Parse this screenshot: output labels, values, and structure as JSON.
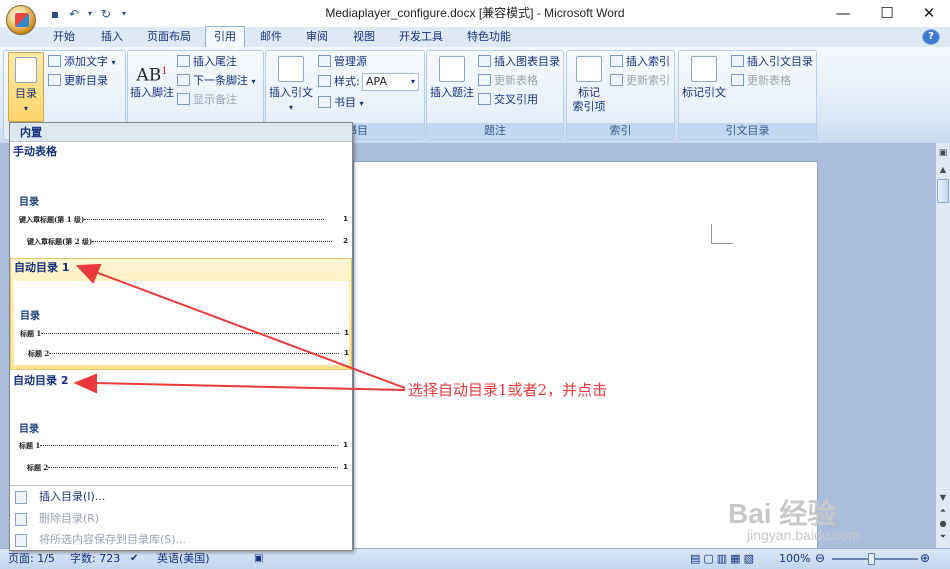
{
  "window": {
    "title": "Mediaplayer_configure.docx [兼容模式] - Microsoft Word"
  },
  "tabs": [
    "开始",
    "插入",
    "页面布局",
    "引用",
    "邮件",
    "审阅",
    "视图",
    "开发工具",
    "特色功能"
  ],
  "active_tab": "引用",
  "ribbon": {
    "toc_group": {
      "toc_button": "目录",
      "add_text": "添加文字",
      "update_toc": "更新目录"
    },
    "footnote_group": {
      "insert_footnote": "插入脚注",
      "ab_label": "AB",
      "insert_endnote": "插入尾注",
      "next_footnote": "下一条脚注",
      "show_notes": "显示备注"
    },
    "citation_group": {
      "insert_citation": "插入引文",
      "manage_sources": "管理源",
      "style_label": "样式:",
      "style_value": "APA",
      "bibliography": "书目",
      "label": "书目"
    },
    "caption_group": {
      "insert_caption": "插入题注",
      "insert_table_of_figures": "插入图表目录",
      "update_table": "更新表格",
      "cross_reference": "交叉引用",
      "label": "题注"
    },
    "index_group": {
      "mark_entry_line1": "标记",
      "mark_entry_line2": "索引项",
      "insert_index": "插入索引",
      "update_index": "更新索引",
      "label": "索引"
    },
    "toa_group": {
      "mark_citation": "标记引文",
      "insert_toa": "插入引文目录",
      "update_table": "更新表格",
      "label": "引文目录"
    }
  },
  "dropdown": {
    "header": "内置",
    "manual": {
      "title": "手动表格",
      "preview_heading": "目录",
      "line1": "键入章标题(第 1 级)",
      "line1_page": "1",
      "line2": "键入章标题(第 2 级)",
      "line2_page": "2"
    },
    "auto1": {
      "title": "自动目录 1",
      "preview_heading": "目录",
      "line1": "标题 1",
      "line1_page": "1",
      "line2": "标题 2",
      "line2_page": "1"
    },
    "auto2": {
      "title": "自动目录 2",
      "preview_heading": "目录",
      "line1": "标题 1",
      "line1_page": "1",
      "line2": "标题 2",
      "line2_page": "1"
    },
    "menu": {
      "insert_toc": "插入目录(I)...",
      "remove_toc": "删除目录(R)",
      "save_selection": "将所选内容保存到目录库(S)..."
    }
  },
  "annotation": {
    "text": "选择自动目录1或者2，并点击",
    "color": "#e83a3a"
  },
  "statusbar": {
    "page": "页面: 1/5",
    "words": "字数: 723",
    "language": "英语(美国)",
    "zoom": "100%"
  },
  "watermark": {
    "brand": "Bai 经验",
    "url": "jingyan.baidu.com"
  }
}
